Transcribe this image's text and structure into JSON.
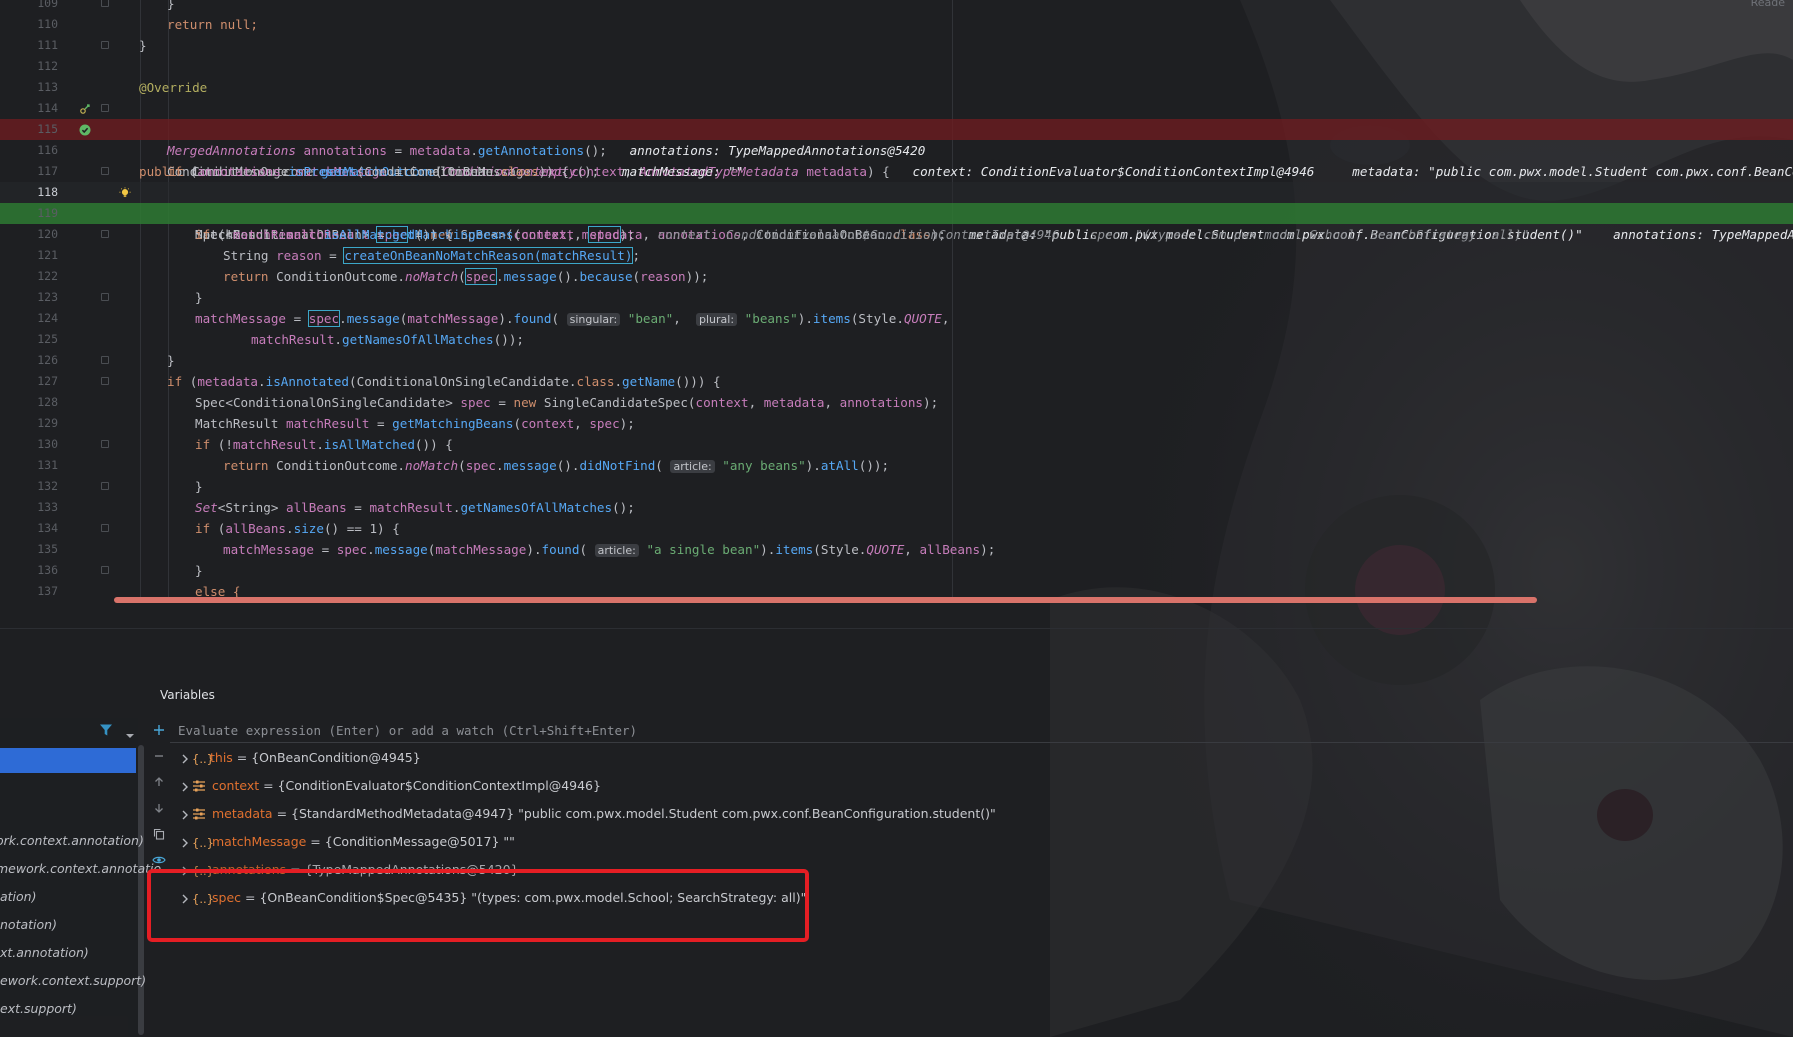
{
  "editor": {
    "lines": [
      {
        "num": "109"
      },
      {
        "num": "110"
      },
      {
        "num": "111"
      },
      {
        "num": "112"
      },
      {
        "num": "113"
      },
      {
        "num": "114"
      },
      {
        "num": "115"
      },
      {
        "num": "116"
      },
      {
        "num": "117"
      },
      {
        "num": "118"
      },
      {
        "num": "119"
      },
      {
        "num": "120"
      },
      {
        "num": "121"
      },
      {
        "num": "122"
      },
      {
        "num": "123"
      },
      {
        "num": "124"
      },
      {
        "num": "125"
      },
      {
        "num": "126"
      },
      {
        "num": "127"
      },
      {
        "num": "128"
      },
      {
        "num": "129"
      },
      {
        "num": "130"
      },
      {
        "num": "131"
      },
      {
        "num": "132"
      },
      {
        "num": "133"
      },
      {
        "num": "134"
      },
      {
        "num": "135"
      },
      {
        "num": "136"
      },
      {
        "num": "137"
      }
    ],
    "top_right_text": "Reade",
    "t": {
      "close_brace": "}",
      "return_null": "return null;",
      "override": "@Override",
      "public": "public",
      "ConditionOutcome": "ConditionOutcome",
      "getMatchOutcome": "getMatchOutcome",
      "ConditionContext": "ConditionContext",
      "context": "context",
      "AnnotatedTypeMetadata": "AnnotatedTypeMetadata",
      "metadata": "metadata",
      "sig_tail": ") {",
      "hint114_ctx": "context: ConditionEvaluator$ConditionContextImpl@4946",
      "hint114_meta": "metadata: \"public com.pwx.model.Student com.pwx.conf.BeanConfiguration.student",
      "ConditionMessage": "ConditionMessage",
      "matchMessage": "matchMessage",
      "empty": "empty",
      "hint115": "matchMessage: \"\"",
      "MergedAnnotations": "MergedAnnotations",
      "annotations": "annotations",
      "getAnnotations": "getAnnotations",
      "hint116": "annotations: TypeMappedAnnotations@5420",
      "if": "if",
      "isPresent": "isPresent",
      "ConditionalOnBean": "ConditionalOnBean",
      "class": "class",
      "Spec": "Spec",
      "spec": "spec",
      "new": "new",
      "hint118_meta": "metadata: \"public com.pwx.model.Student com.pwx.conf.BeanConfiguration.student()\"",
      "hint118_ann": "annotations: TypeMappedAnnotations@5420",
      "MatchResult": "MatchResult",
      "matchResult": "matchResult",
      "getMatchingBeans": "getMatchingBeans",
      "hint119_ctx": "context: ConditionEvaluator$ConditionContextImpl@4946",
      "hint119_spec": "spec: \"(types: com.pwx.model.School; SearchStrategy: all)\"",
      "isAllMatched": "isAllMatched",
      "String": "String",
      "reason": "reason",
      "createReason": "createOnBeanNoMatchReason(matchResult)",
      "return": "return",
      "noMatch": "noMatch",
      "message": "message",
      "because": "because",
      "found": "found",
      "singular": "singular:",
      "bean": "\"bean\"",
      "plural": "plural:",
      "beans": "\"beans\"",
      "items": "items",
      "Style": "Style",
      "QUOTE": "QUOTE",
      "getNamesOfAllMatches": "getNamesOfAllMatches",
      "isAnnotated": "isAnnotated",
      "ConditionalOnSingleCandidate": "ConditionalOnSingleCandidate",
      "getName": "getName",
      "SingleCandidateSpec": "SingleCandidateSpec",
      "didNotFind": "didNotFind",
      "article": "article:",
      "any_beans": "\"any beans\"",
      "atAll": "atAll",
      "Set": "Set",
      "allBeans": "allBeans",
      "size": "size",
      "eq1": "== 1",
      "single_bean": "\"a single bean\"",
      "else": "else {"
    }
  },
  "variables_panel": {
    "title": "Variables",
    "eval_placeholder": "Evaluate expression (Enter) or add a watch (Ctrl+Shift+Enter)",
    "frames": [
      "ork.context.annotation)",
      "mework.context.annotatio",
      "ation)",
      "notation)",
      "xt.annotation)",
      "ework.context.support)",
      "ext.support)"
    ],
    "variables": [
      {
        "name": "this",
        "eq": " = ",
        "value": "{OnBeanCondition@4945}",
        "extra": "",
        "icon": "{..}"
      },
      {
        "name": "context",
        "eq": " = ",
        "value": "{ConditionEvaluator$ConditionContextImpl@4946}",
        "extra": "",
        "icon": "field-icon"
      },
      {
        "name": "metadata",
        "eq": " = ",
        "value": "{StandardMethodMetadata@4947}",
        "extra": " \"public com.pwx.model.Student com.pwx.conf.BeanConfiguration.student()\"",
        "icon": "field-icon"
      },
      {
        "name": "matchMessage",
        "eq": " = ",
        "value": "{ConditionMessage@5017}",
        "extra": " \"\"",
        "icon": "{..}"
      },
      {
        "name": "annotations",
        "eq": " = ",
        "value": "{TypeMappedAnnotations@5420}",
        "extra": "",
        "icon": "{..}"
      },
      {
        "name": "spec",
        "eq": " = ",
        "value": "{OnBeanCondition$Spec@5435}",
        "extra": " \"(types: com.pwx.model.School; SearchStrategy: all)\"",
        "icon": "{..}"
      }
    ]
  },
  "colors": {
    "error_line": "#6e1c20",
    "execution_line": "#2e7832",
    "highlight_box": "#e51e24",
    "selected_frame": "#2e6bd6"
  }
}
